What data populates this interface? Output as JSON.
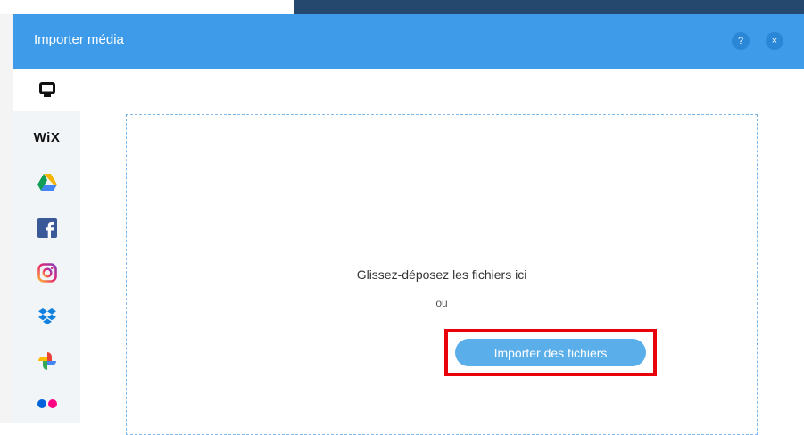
{
  "dialog": {
    "title": "Importer média",
    "help_label": "?",
    "close_label": "×"
  },
  "sidebar": {
    "items": [
      {
        "name": "computer",
        "icon": "monitor-icon",
        "active": true
      },
      {
        "name": "wix",
        "label": "WiX",
        "icon": "wix-icon"
      },
      {
        "name": "google-drive",
        "icon": "google-drive-icon"
      },
      {
        "name": "facebook",
        "icon": "facebook-icon"
      },
      {
        "name": "instagram",
        "icon": "instagram-icon"
      },
      {
        "name": "dropbox",
        "icon": "dropbox-icon"
      },
      {
        "name": "google-photos",
        "icon": "google-photos-icon"
      },
      {
        "name": "flickr",
        "icon": "flickr-icon"
      }
    ]
  },
  "dropzone": {
    "instruction": "Glissez-déposez les fichiers ici",
    "or": "ou",
    "button_label": "Importer des fichiers"
  },
  "colors": {
    "header": "#3d9be9",
    "button": "#5aaeea",
    "highlight": "#e8000b",
    "dropzone_border": "#7fb8ec"
  }
}
